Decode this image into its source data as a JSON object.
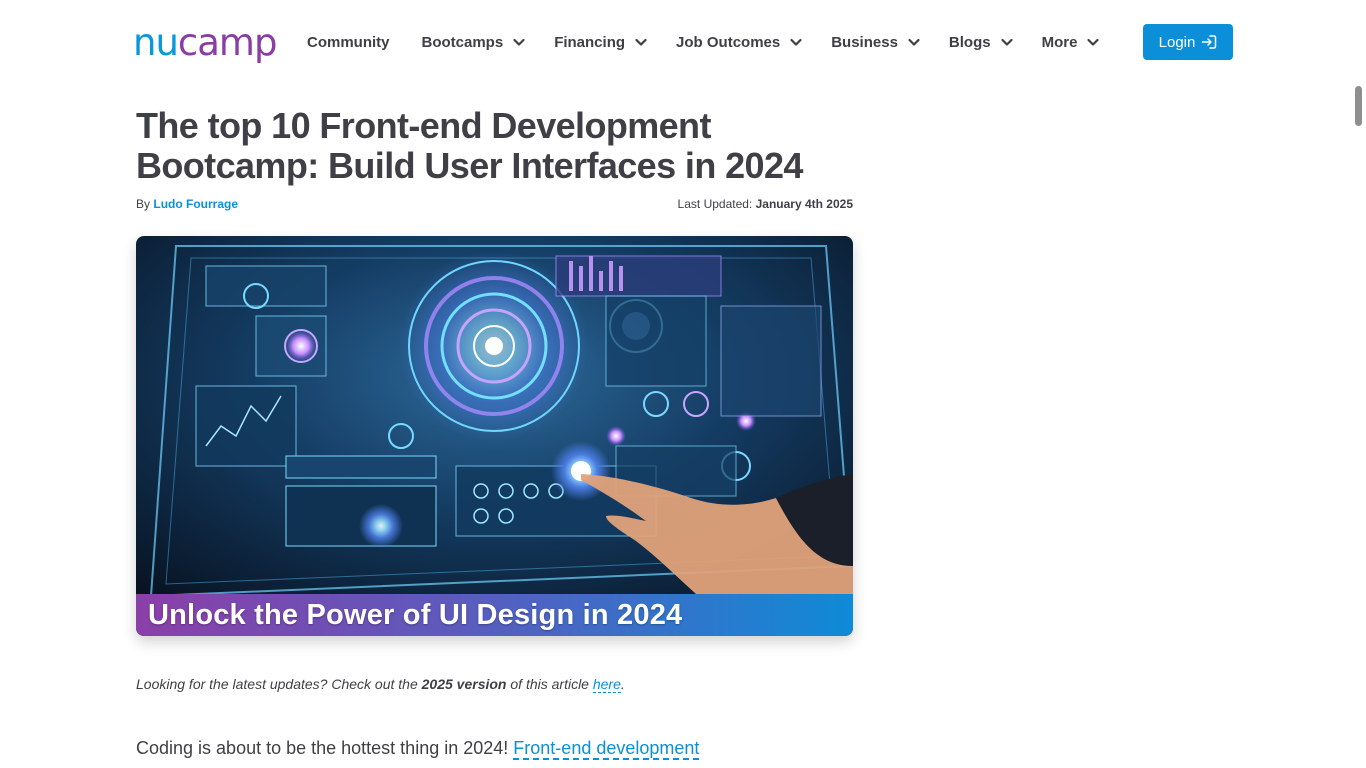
{
  "header": {
    "logo": {
      "part1": "nu",
      "part2": "camp",
      "colors": {
        "primary": "#0b97db",
        "secondary": "#8a3ea5"
      }
    },
    "nav": [
      {
        "label": "Community",
        "has_dropdown": false
      },
      {
        "label": "Bootcamps",
        "has_dropdown": true
      },
      {
        "label": "Financing",
        "has_dropdown": true
      },
      {
        "label": "Job Outcomes",
        "has_dropdown": true
      },
      {
        "label": "Business",
        "has_dropdown": true
      },
      {
        "label": "Blogs",
        "has_dropdown": true
      },
      {
        "label": "More",
        "has_dropdown": true
      }
    ],
    "login": {
      "label": "Login",
      "icon": "login-arrow-icon",
      "color": "#0b8fd8"
    }
  },
  "article": {
    "title": "The top 10 Front-end Development Bootcamp: Build User Interfaces in 2024",
    "by_label": "By",
    "author": "Ludo Fourrage",
    "last_updated_label": "Last Updated:",
    "last_updated": "January 4th 2025",
    "hero": {
      "caption": "Unlock the Power of UI Design in 2024"
    },
    "note": {
      "prefix": "Looking for the latest updates? Check out the",
      "bold": "2025 version",
      "middle": "of this article",
      "link": "here",
      "suffix": "."
    },
    "body": {
      "text": "Coding is about to be the hottest thing in 2024!",
      "link": "Front-end development"
    }
  }
}
